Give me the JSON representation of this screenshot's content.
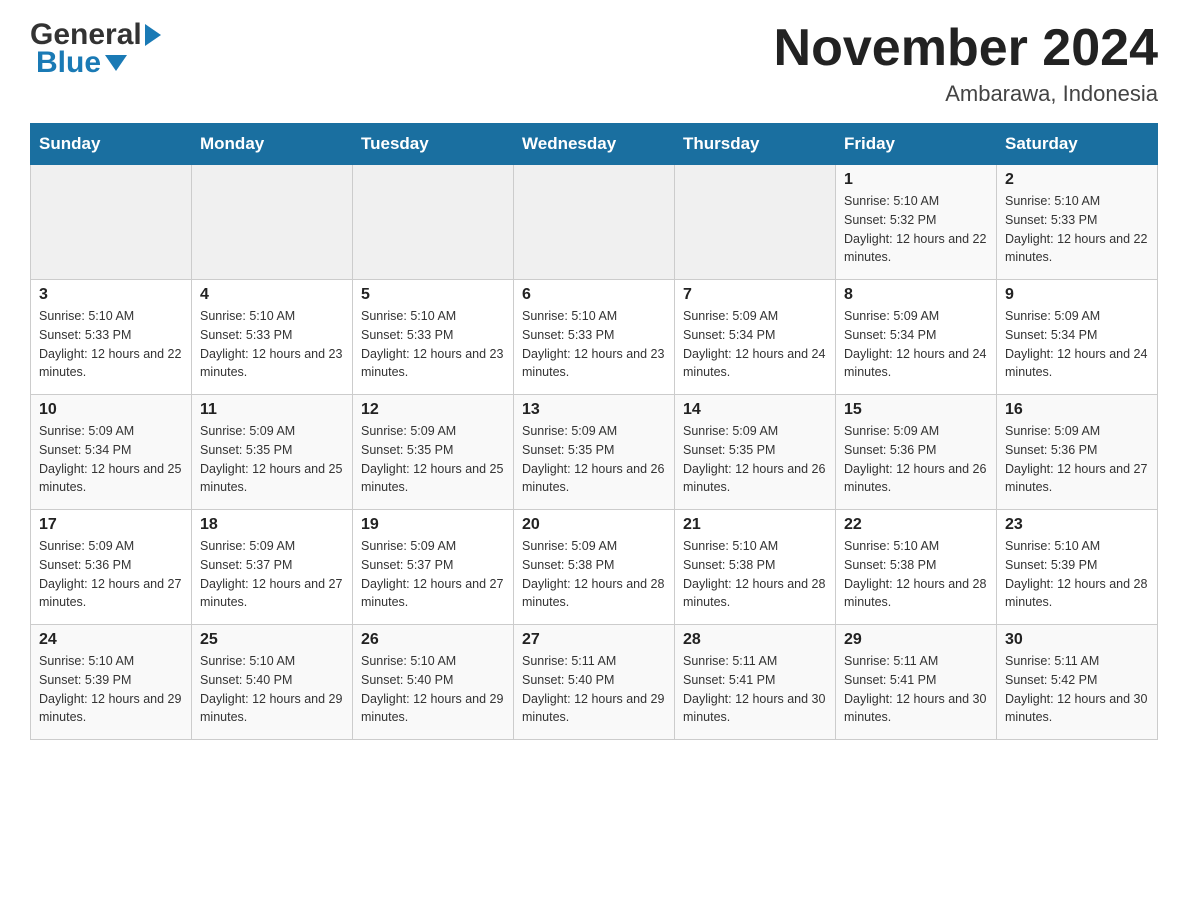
{
  "header": {
    "logo_general": "General",
    "logo_blue": "Blue",
    "title": "November 2024",
    "subtitle": "Ambarawa, Indonesia"
  },
  "calendar": {
    "days_of_week": [
      "Sunday",
      "Monday",
      "Tuesday",
      "Wednesday",
      "Thursday",
      "Friday",
      "Saturday"
    ],
    "weeks": [
      {
        "cells": [
          {
            "date": "",
            "sunrise": "",
            "sunset": "",
            "daylight": ""
          },
          {
            "date": "",
            "sunrise": "",
            "sunset": "",
            "daylight": ""
          },
          {
            "date": "",
            "sunrise": "",
            "sunset": "",
            "daylight": ""
          },
          {
            "date": "",
            "sunrise": "",
            "sunset": "",
            "daylight": ""
          },
          {
            "date": "",
            "sunrise": "",
            "sunset": "",
            "daylight": ""
          },
          {
            "date": "1",
            "sunrise": "Sunrise: 5:10 AM",
            "sunset": "Sunset: 5:32 PM",
            "daylight": "Daylight: 12 hours and 22 minutes."
          },
          {
            "date": "2",
            "sunrise": "Sunrise: 5:10 AM",
            "sunset": "Sunset: 5:33 PM",
            "daylight": "Daylight: 12 hours and 22 minutes."
          }
        ]
      },
      {
        "cells": [
          {
            "date": "3",
            "sunrise": "Sunrise: 5:10 AM",
            "sunset": "Sunset: 5:33 PM",
            "daylight": "Daylight: 12 hours and 22 minutes."
          },
          {
            "date": "4",
            "sunrise": "Sunrise: 5:10 AM",
            "sunset": "Sunset: 5:33 PM",
            "daylight": "Daylight: 12 hours and 23 minutes."
          },
          {
            "date": "5",
            "sunrise": "Sunrise: 5:10 AM",
            "sunset": "Sunset: 5:33 PM",
            "daylight": "Daylight: 12 hours and 23 minutes."
          },
          {
            "date": "6",
            "sunrise": "Sunrise: 5:10 AM",
            "sunset": "Sunset: 5:33 PM",
            "daylight": "Daylight: 12 hours and 23 minutes."
          },
          {
            "date": "7",
            "sunrise": "Sunrise: 5:09 AM",
            "sunset": "Sunset: 5:34 PM",
            "daylight": "Daylight: 12 hours and 24 minutes."
          },
          {
            "date": "8",
            "sunrise": "Sunrise: 5:09 AM",
            "sunset": "Sunset: 5:34 PM",
            "daylight": "Daylight: 12 hours and 24 minutes."
          },
          {
            "date": "9",
            "sunrise": "Sunrise: 5:09 AM",
            "sunset": "Sunset: 5:34 PM",
            "daylight": "Daylight: 12 hours and 24 minutes."
          }
        ]
      },
      {
        "cells": [
          {
            "date": "10",
            "sunrise": "Sunrise: 5:09 AM",
            "sunset": "Sunset: 5:34 PM",
            "daylight": "Daylight: 12 hours and 25 minutes."
          },
          {
            "date": "11",
            "sunrise": "Sunrise: 5:09 AM",
            "sunset": "Sunset: 5:35 PM",
            "daylight": "Daylight: 12 hours and 25 minutes."
          },
          {
            "date": "12",
            "sunrise": "Sunrise: 5:09 AM",
            "sunset": "Sunset: 5:35 PM",
            "daylight": "Daylight: 12 hours and 25 minutes."
          },
          {
            "date": "13",
            "sunrise": "Sunrise: 5:09 AM",
            "sunset": "Sunset: 5:35 PM",
            "daylight": "Daylight: 12 hours and 26 minutes."
          },
          {
            "date": "14",
            "sunrise": "Sunrise: 5:09 AM",
            "sunset": "Sunset: 5:35 PM",
            "daylight": "Daylight: 12 hours and 26 minutes."
          },
          {
            "date": "15",
            "sunrise": "Sunrise: 5:09 AM",
            "sunset": "Sunset: 5:36 PM",
            "daylight": "Daylight: 12 hours and 26 minutes."
          },
          {
            "date": "16",
            "sunrise": "Sunrise: 5:09 AM",
            "sunset": "Sunset: 5:36 PM",
            "daylight": "Daylight: 12 hours and 27 minutes."
          }
        ]
      },
      {
        "cells": [
          {
            "date": "17",
            "sunrise": "Sunrise: 5:09 AM",
            "sunset": "Sunset: 5:36 PM",
            "daylight": "Daylight: 12 hours and 27 minutes."
          },
          {
            "date": "18",
            "sunrise": "Sunrise: 5:09 AM",
            "sunset": "Sunset: 5:37 PM",
            "daylight": "Daylight: 12 hours and 27 minutes."
          },
          {
            "date": "19",
            "sunrise": "Sunrise: 5:09 AM",
            "sunset": "Sunset: 5:37 PM",
            "daylight": "Daylight: 12 hours and 27 minutes."
          },
          {
            "date": "20",
            "sunrise": "Sunrise: 5:09 AM",
            "sunset": "Sunset: 5:38 PM",
            "daylight": "Daylight: 12 hours and 28 minutes."
          },
          {
            "date": "21",
            "sunrise": "Sunrise: 5:10 AM",
            "sunset": "Sunset: 5:38 PM",
            "daylight": "Daylight: 12 hours and 28 minutes."
          },
          {
            "date": "22",
            "sunrise": "Sunrise: 5:10 AM",
            "sunset": "Sunset: 5:38 PM",
            "daylight": "Daylight: 12 hours and 28 minutes."
          },
          {
            "date": "23",
            "sunrise": "Sunrise: 5:10 AM",
            "sunset": "Sunset: 5:39 PM",
            "daylight": "Daylight: 12 hours and 28 minutes."
          }
        ]
      },
      {
        "cells": [
          {
            "date": "24",
            "sunrise": "Sunrise: 5:10 AM",
            "sunset": "Sunset: 5:39 PM",
            "daylight": "Daylight: 12 hours and 29 minutes."
          },
          {
            "date": "25",
            "sunrise": "Sunrise: 5:10 AM",
            "sunset": "Sunset: 5:40 PM",
            "daylight": "Daylight: 12 hours and 29 minutes."
          },
          {
            "date": "26",
            "sunrise": "Sunrise: 5:10 AM",
            "sunset": "Sunset: 5:40 PM",
            "daylight": "Daylight: 12 hours and 29 minutes."
          },
          {
            "date": "27",
            "sunrise": "Sunrise: 5:11 AM",
            "sunset": "Sunset: 5:40 PM",
            "daylight": "Daylight: 12 hours and 29 minutes."
          },
          {
            "date": "28",
            "sunrise": "Sunrise: 5:11 AM",
            "sunset": "Sunset: 5:41 PM",
            "daylight": "Daylight: 12 hours and 30 minutes."
          },
          {
            "date": "29",
            "sunrise": "Sunrise: 5:11 AM",
            "sunset": "Sunset: 5:41 PM",
            "daylight": "Daylight: 12 hours and 30 minutes."
          },
          {
            "date": "30",
            "sunrise": "Sunrise: 5:11 AM",
            "sunset": "Sunset: 5:42 PM",
            "daylight": "Daylight: 12 hours and 30 minutes."
          }
        ]
      }
    ]
  }
}
